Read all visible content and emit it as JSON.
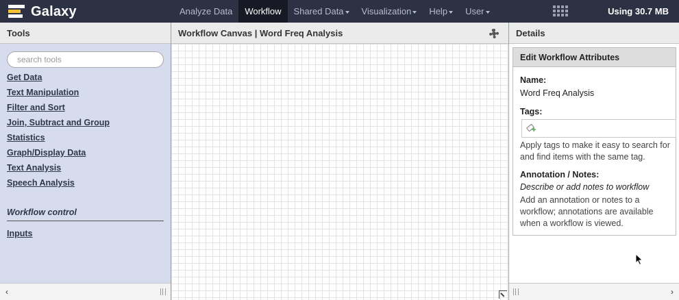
{
  "masthead": {
    "brand": "Galaxy",
    "nav": [
      {
        "label": "Analyze Data",
        "active": false,
        "dropdown": false
      },
      {
        "label": "Workflow",
        "active": true,
        "dropdown": false
      },
      {
        "label": "Shared Data",
        "active": false,
        "dropdown": true
      },
      {
        "label": "Visualization",
        "active": false,
        "dropdown": true
      },
      {
        "label": "Help",
        "active": false,
        "dropdown": true
      },
      {
        "label": "User",
        "active": false,
        "dropdown": true
      }
    ],
    "apps_icon": "grid-icon",
    "quota": "Using 30.7 MB",
    "colors": {
      "bar": "#2c3143",
      "active": "#171a24",
      "logo_accent": "#f5c233"
    }
  },
  "tools": {
    "title": "Tools",
    "search_placeholder": "search tools",
    "sections": [
      "Get Data",
      "Text Manipulation",
      "Filter and Sort",
      "Join, Subtract and Group",
      "Statistics",
      "Graph/Display Data",
      "Text Analysis",
      "Speech Analysis"
    ],
    "workflow_control_label": "Workflow control",
    "inputs_label": "Inputs"
  },
  "canvas": {
    "title": "Workflow Canvas | Word Freq Analysis",
    "options_icon": "gear-icon"
  },
  "details": {
    "title": "Details",
    "box_title": "Edit Workflow Attributes",
    "name_label": "Name:",
    "name_value": "Word Freq Analysis",
    "tags_label": "Tags:",
    "tags_help": "Apply tags to make it easy to search for and find items with the same tag.",
    "annotation_label": "Annotation / Notes:",
    "annotation_placeholder": "Describe or add notes to workflow",
    "annotation_help": "Add an annotation or notes to a workflow; annotations are available when a workflow is viewed."
  }
}
